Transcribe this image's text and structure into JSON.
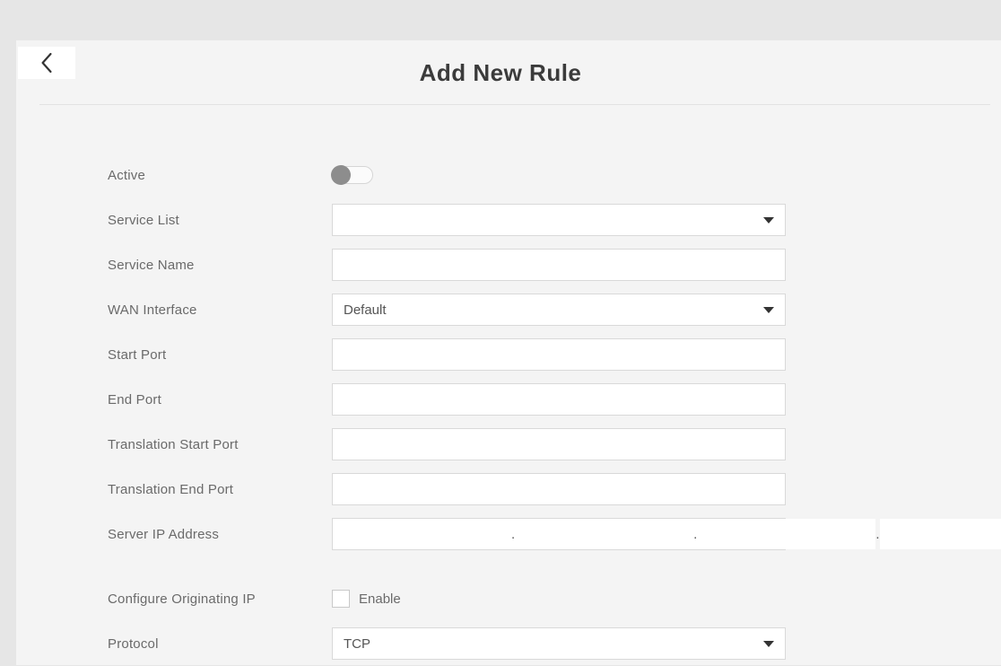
{
  "title": "Add New Rule",
  "labels": {
    "active": "Active",
    "service_list": "Service List",
    "service_name": "Service Name",
    "wan_interface": "WAN Interface",
    "start_port": "Start Port",
    "end_port": "End Port",
    "trans_start_port": "Translation Start Port",
    "trans_end_port": "Translation End Port",
    "server_ip": "Server IP Address",
    "config_orig_ip": "Configure Originating IP",
    "protocol": "Protocol"
  },
  "values": {
    "active": false,
    "service_list": "",
    "service_name": "",
    "wan_interface": "Default",
    "start_port": "",
    "end_port": "",
    "trans_start_port": "",
    "trans_end_port": "",
    "server_ip": {
      "a": "",
      "b": "",
      "c": "",
      "d": ""
    },
    "config_orig_ip_enabled": false,
    "config_orig_ip_label": "Enable",
    "protocol": "TCP"
  },
  "ipdot": "."
}
